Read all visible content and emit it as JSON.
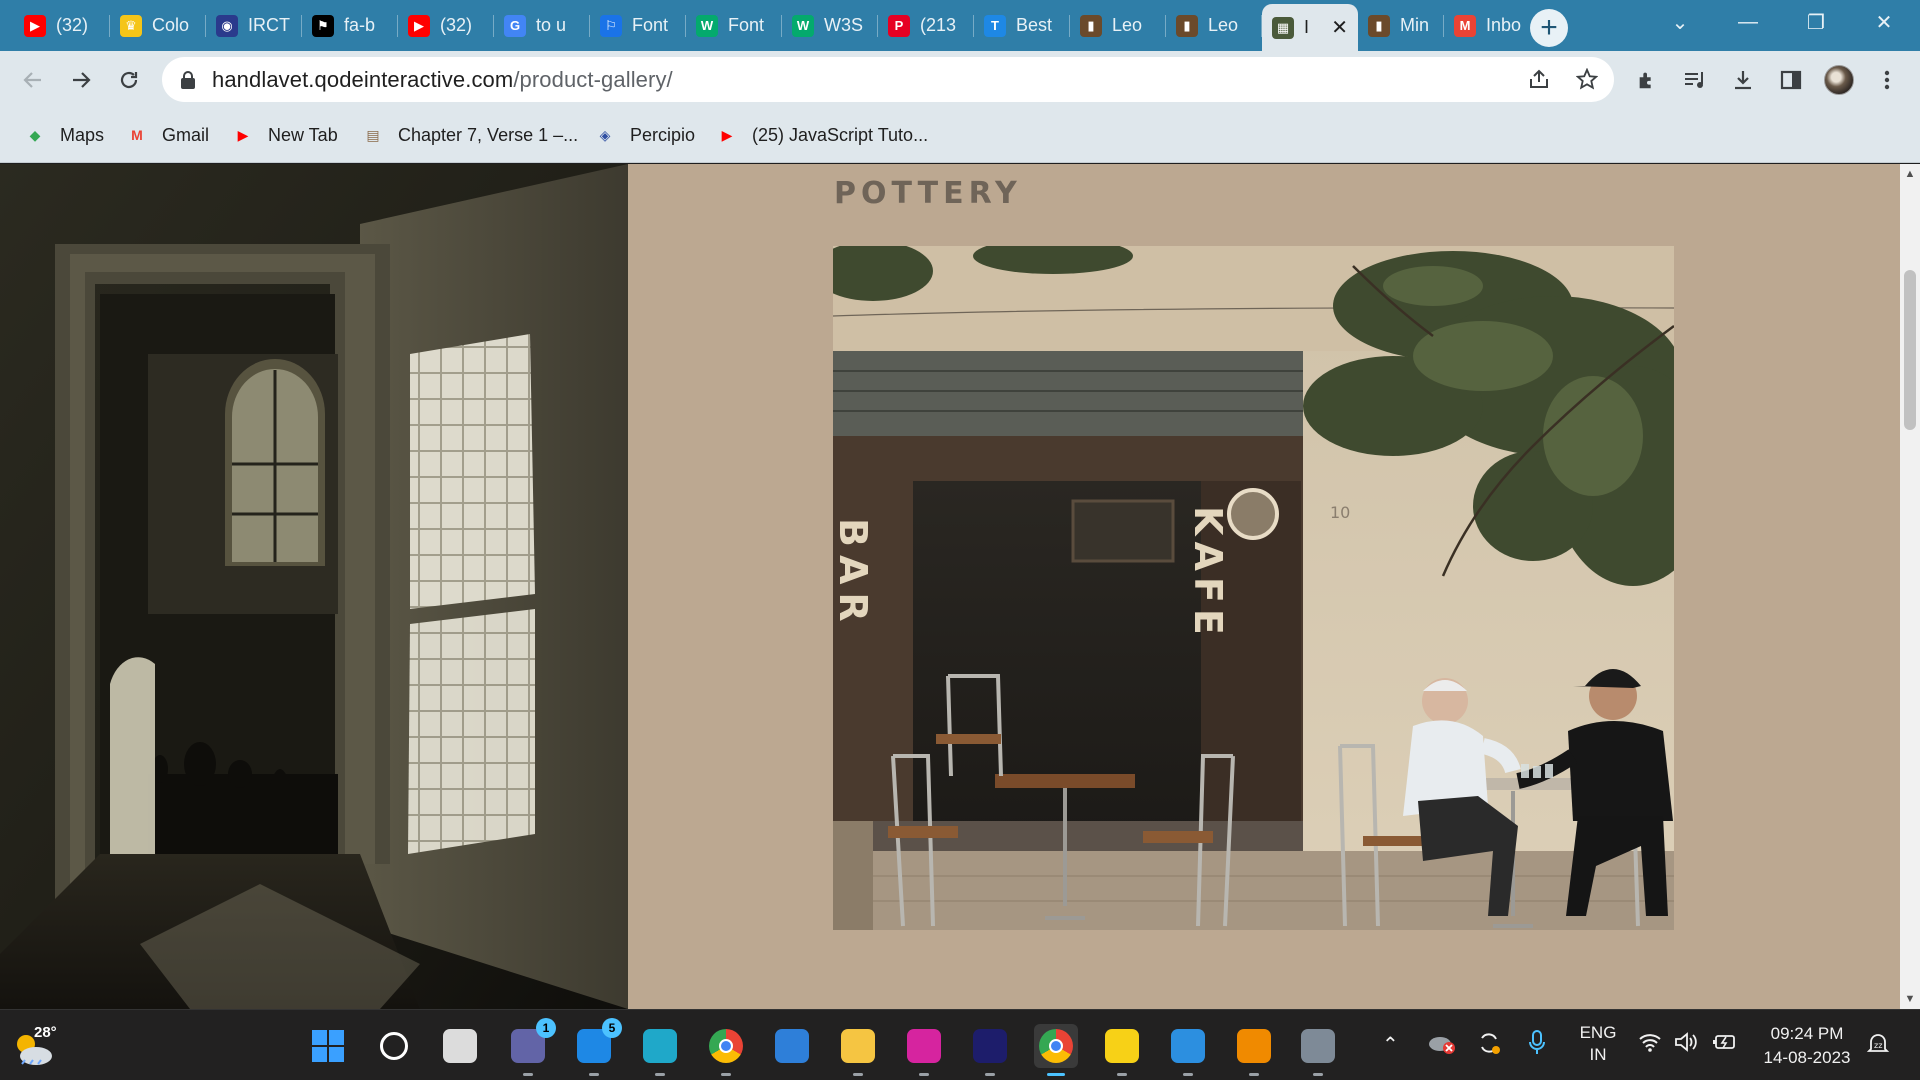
{
  "tabs": [
    {
      "label": "(32)",
      "icon": "youtube-icon",
      "color": "#ff0000"
    },
    {
      "label": "Colo",
      "icon": "trophy-icon",
      "color": "#f5c518"
    },
    {
      "label": "IRCT",
      "icon": "irctc-icon",
      "color": "#2a3a8c"
    },
    {
      "label": "fa-b",
      "icon": "flag-icon",
      "color": "#000000"
    },
    {
      "label": "(32)",
      "icon": "youtube-icon",
      "color": "#ff0000"
    },
    {
      "label": "to u",
      "icon": "google-icon",
      "color": "#4285f4"
    },
    {
      "label": "Font",
      "icon": "flag-outline-icon",
      "color": "#1a73e8"
    },
    {
      "label": "Font",
      "icon": "w3-icon",
      "color": "#04aa6d"
    },
    {
      "label": "W3S",
      "icon": "w3-icon",
      "color": "#04aa6d"
    },
    {
      "label": "(213",
      "icon": "pinterest-icon",
      "color": "#e60023"
    },
    {
      "label": "Best",
      "icon": "t-icon",
      "color": "#1e88e5"
    },
    {
      "label": "Leo",
      "icon": "painting-icon",
      "color": "#6b4a2b"
    },
    {
      "label": "Leo",
      "icon": "painting-icon",
      "color": "#6b4a2b"
    },
    {
      "label": "I",
      "icon": "site-icon",
      "color": "#4a5a3a"
    },
    {
      "label": "Min",
      "icon": "painting-icon",
      "color": "#6b4a2b"
    },
    {
      "label": "Inbo",
      "icon": "gmail-icon",
      "color": "#ea4335"
    }
  ],
  "active_tab_index": 13,
  "window_controls": {
    "list": "⌄",
    "minimize": "—",
    "restore": "❐",
    "close": "✕"
  },
  "address_bar": {
    "domain": "handlavet.qodeinteractive.com",
    "path": "/product-gallery/"
  },
  "bookmarks": [
    {
      "label": "Maps",
      "icon": "maps-icon",
      "color": "#34a853"
    },
    {
      "label": "Gmail",
      "icon": "gmail-icon",
      "color": "#ea4335"
    },
    {
      "label": "New Tab",
      "icon": "youtube-icon",
      "color": "#ff0000"
    },
    {
      "label": "Chapter 7, Verse 1 –...",
      "icon": "book-icon",
      "color": "#8a6a4a"
    },
    {
      "label": "Percipio",
      "icon": "percipio-icon",
      "color": "#2f4fa2"
    },
    {
      "label": "(25) JavaScript Tuto...",
      "icon": "youtube-icon",
      "color": "#ff0000"
    }
  ],
  "page": {
    "section_title": "POTTERY",
    "background": "#bca891",
    "cafe_sign_bar": "BAR",
    "cafe_sign_kafe": "KAFE",
    "cafe_number": "10"
  },
  "taskbar": {
    "weather_temp": "28°",
    "apps": [
      {
        "name": "start-button"
      },
      {
        "name": "search-button"
      },
      {
        "name": "task-view-button"
      },
      {
        "name": "teams-app",
        "badge": "1"
      },
      {
        "name": "mail-app",
        "badge": "5"
      },
      {
        "name": "edge-app"
      },
      {
        "name": "chrome-app"
      },
      {
        "name": "store-app"
      },
      {
        "name": "file-explorer-app"
      },
      {
        "name": "instagram-app"
      },
      {
        "name": "webex-app"
      },
      {
        "name": "chrome-profile-app"
      },
      {
        "name": "sticky-notes-app"
      },
      {
        "name": "vscode-app"
      },
      {
        "name": "vlc-app"
      },
      {
        "name": "settings-app"
      }
    ],
    "language_line1": "ENG",
    "language_line2": "IN",
    "time": "09:24 PM",
    "date": "14-08-2023"
  }
}
